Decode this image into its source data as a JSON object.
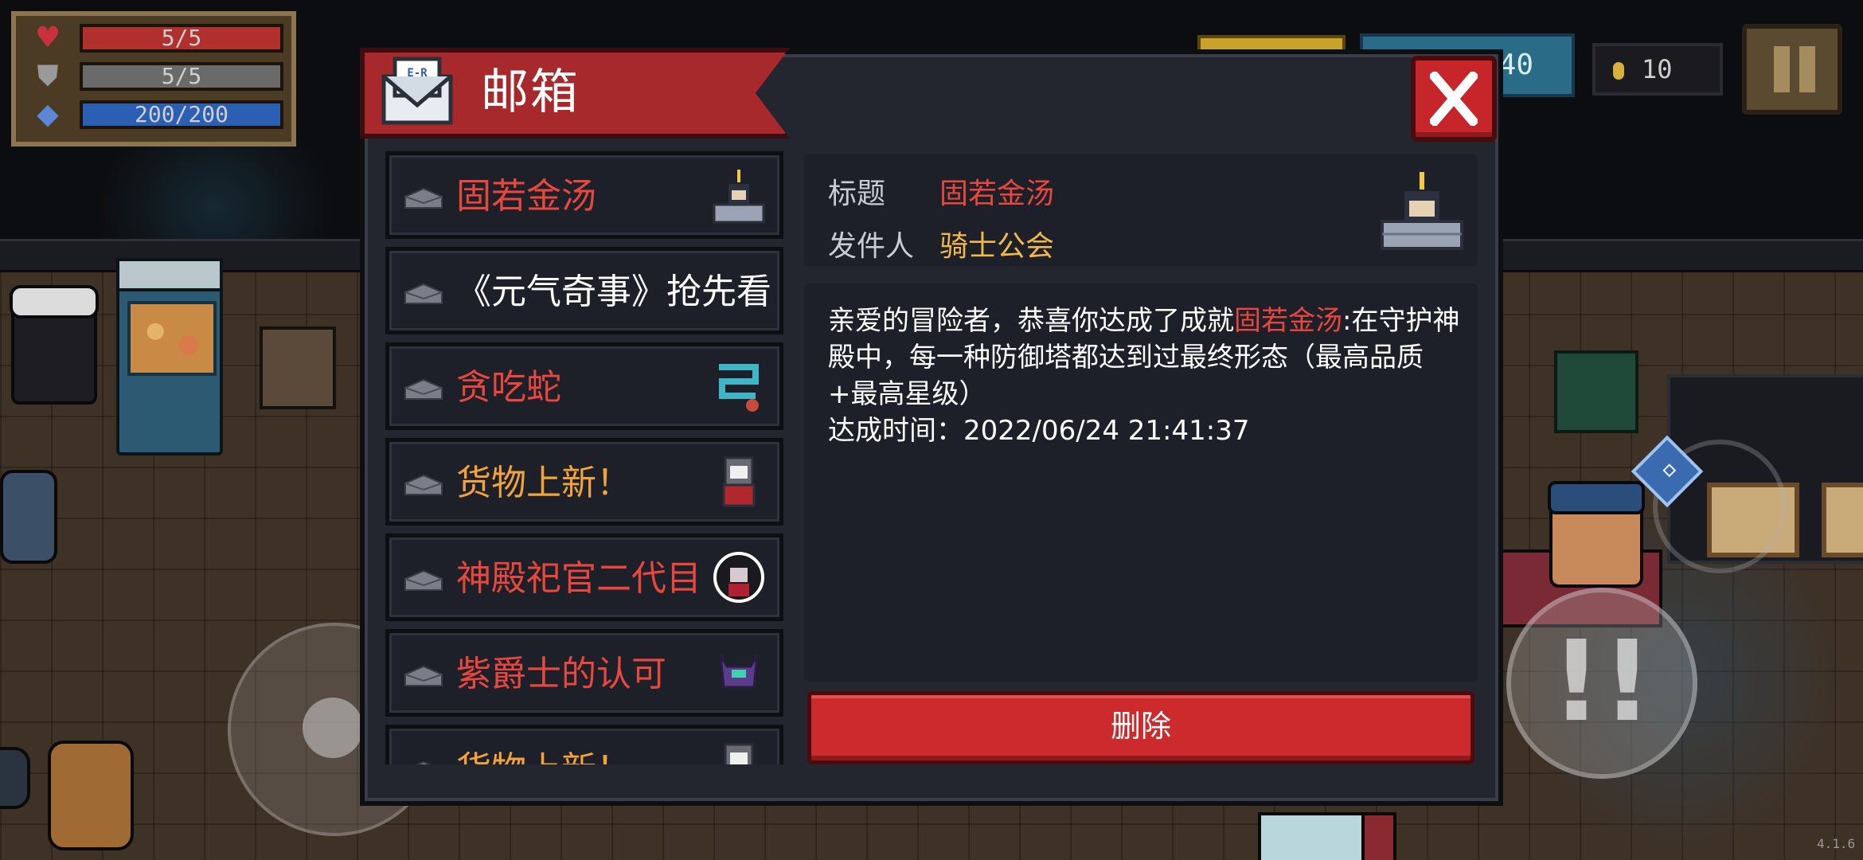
{
  "hud": {
    "hp": "5/5",
    "armor": "5/5",
    "energy": "200/200",
    "gems": "40",
    "coins": "10",
    "version": "4.1.6"
  },
  "mailbox": {
    "title": "邮箱",
    "mail_icon_text": "E-R MAIL",
    "list": [
      {
        "label": "固若金汤",
        "color": "#e8473e",
        "avatar": "knight-on-wall"
      },
      {
        "label": "《元气奇事》抢先看",
        "color": "#ffffff",
        "avatar": "none"
      },
      {
        "label": "贪吃蛇",
        "color": "#e8473e",
        "avatar": "snake-pipe"
      },
      {
        "label": "货物上新！",
        "color": "#f2a33a",
        "avatar": "merchant"
      },
      {
        "label": "神殿祀官二代目",
        "color": "#e8473e",
        "avatar": "priest"
      },
      {
        "label": "紫爵士的认可",
        "color": "#e8473e",
        "avatar": "purple-knight"
      },
      {
        "label": "货物上新！",
        "color": "#f2a33a",
        "avatar": "merchant"
      }
    ],
    "detail": {
      "subject_label": "标题",
      "subject": "固若金汤",
      "sender_label": "发件人",
      "sender": "骑士公会",
      "body_intro": "亲爱的冒险者，恭喜你达成了成就",
      "body_highlight": "固若金汤",
      "body_rest": ":在守护神殿中，每一种防御塔都达到过最终形态（最高品质+最高星级）",
      "body_time": "达成时间：2022/06/24 21:41:37"
    },
    "delete_label": "删除"
  }
}
